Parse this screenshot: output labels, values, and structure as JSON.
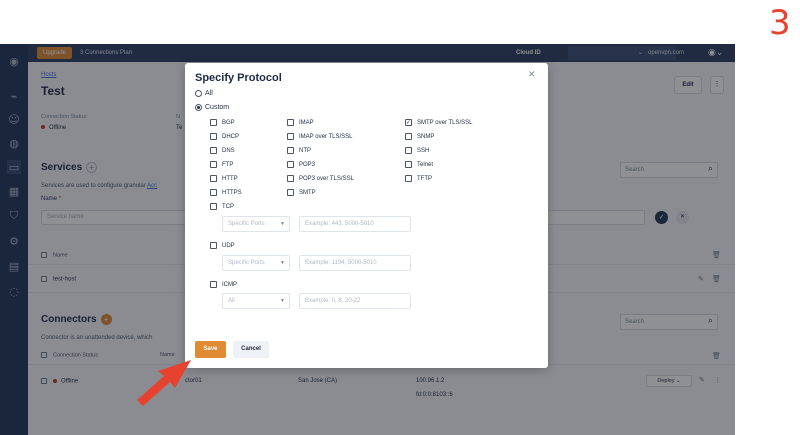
{
  "step_number": "3",
  "topbar": {
    "upgrade": "Upgrade",
    "plan": "3 Connections Plan",
    "cloud_id_label": "Cloud ID",
    "user": "openvpn.com"
  },
  "page": {
    "breadcrumb": "Hosts",
    "title": "Test",
    "edit": "Edit",
    "connection_status_label": "Connection Status:",
    "connection_status_value": "Offline",
    "partial_label": "N",
    "partial_value": "Te"
  },
  "services": {
    "heading": "Services",
    "search_placeholder": "Search",
    "description": "Services are used to configure granular",
    "description_link": "Acc",
    "name_label": "Name",
    "name_placeholder": "Service name",
    "col_name": "Name",
    "rows": [
      {
        "name": "test-host"
      }
    ]
  },
  "connectors": {
    "heading": "Connectors",
    "search_placeholder": "Search",
    "description": "Connector is an unattended device, which",
    "col_status": "Connection Status",
    "col_name": "Name",
    "rows": [
      {
        "status": "Offline",
        "name_fragment": "ctor01",
        "location": "San Jose (CA)",
        "ip4": "100.96.1.2",
        "ip6": "fd:0:0:8103::6",
        "deploy": "Deploy"
      }
    ]
  },
  "modal": {
    "title": "Specify Protocol",
    "radio_all": "All",
    "radio_custom": "Custom",
    "selected_radio": "Custom",
    "protocols_col1": [
      "BGP",
      "DHCP",
      "DNS",
      "FTP",
      "HTTP",
      "HTTPS",
      "TCP"
    ],
    "protocols_col2": [
      "IMAP",
      "IMAP over TLS/SSL",
      "NTP",
      "POP3",
      "POP3 over TLS/SSL",
      "SMTP"
    ],
    "protocols_col3": [
      "SMTP over TLS/SSL",
      "SNMP",
      "SSH",
      "Telnet",
      "TFTP"
    ],
    "checked": [
      "SMTP over TLS/SSL"
    ],
    "tcp_select": "Specific Ports",
    "tcp_placeholder": "Example: 443, 5000-5010",
    "udp_label": "UDP",
    "udp_select": "Specific Ports",
    "udp_placeholder": "Example: 1194, 5000-5010",
    "icmp_label": "ICMP",
    "icmp_select": "All",
    "icmp_placeholder": "Example: 0, 8, 20-22",
    "save": "Save",
    "cancel": "Cancel"
  },
  "colors": {
    "accent": "#e08a34",
    "sidebar": "#1f3457",
    "annotation": "#e5432f"
  }
}
